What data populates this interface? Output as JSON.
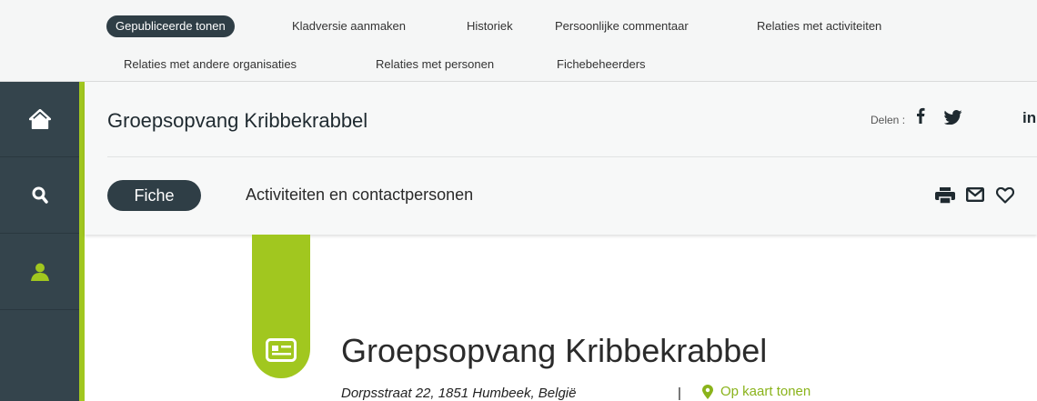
{
  "admin_tabs": [
    {
      "label": "Gepubliceerde tonen"
    },
    {
      "label": "Kladversie aanmaken"
    },
    {
      "label": "Historiek"
    },
    {
      "label": "Persoonlijke commentaar"
    },
    {
      "label": "Relaties met activiteiten"
    },
    {
      "label": "Relaties met andere organisaties"
    },
    {
      "label": "Relaties met personen"
    },
    {
      "label": "Fichebeheerders"
    }
  ],
  "sidebar": {
    "items": [
      {
        "icon": "home-icon"
      },
      {
        "icon": "search-icon"
      },
      {
        "icon": "user-icon"
      }
    ]
  },
  "header": {
    "title": "Groepsopvang Kribbekrabbel",
    "share_label": "Delen :",
    "share_icons": [
      "facebook-icon",
      "twitter-icon",
      "linkedin-icon"
    ],
    "tabs": [
      {
        "label": "Fiche",
        "active": true
      },
      {
        "label": "Activiteiten en contactpersonen"
      }
    ],
    "tools": [
      "print-icon",
      "mail-icon",
      "heart-icon"
    ]
  },
  "main": {
    "title": "Groepsopvang Kribbekrabbel",
    "address": "Dorpsstraat 22, 1851 Humbeek, België",
    "separator": "|",
    "map_link": "Op kaart tonen"
  },
  "colors": {
    "accent_green": "#a1c71f",
    "dark": "#2f3e46",
    "sidebar": "#34444c"
  }
}
